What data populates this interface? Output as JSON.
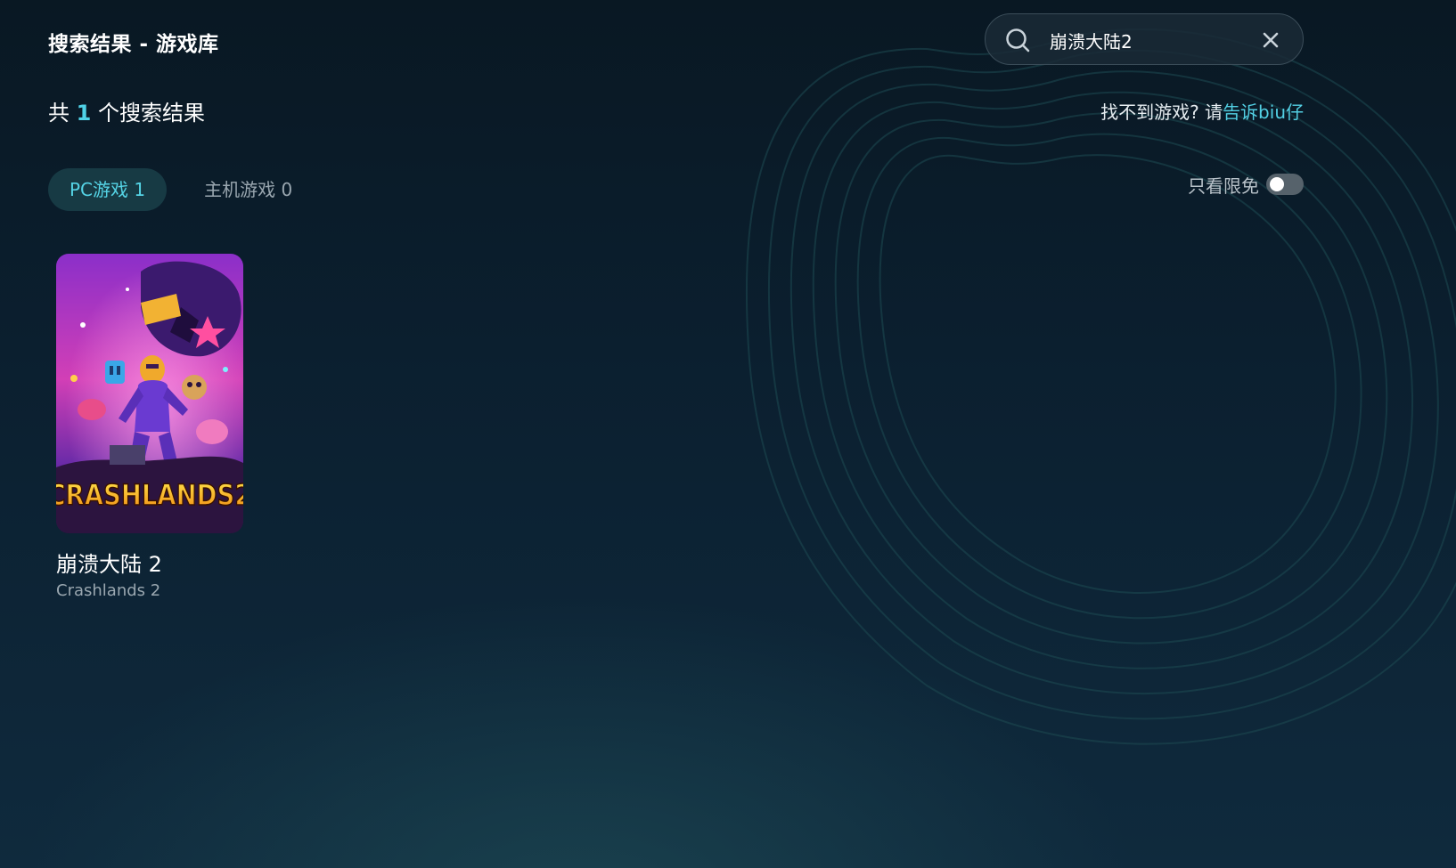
{
  "page": {
    "title": "搜索结果 - 游戏库"
  },
  "search": {
    "value": "崩溃大陆2",
    "placeholder": ""
  },
  "results": {
    "prefix": "共",
    "count": "1",
    "suffix": "个搜索结果"
  },
  "feedback": {
    "text": "找不到游戏? 请",
    "link": "告诉biu仔"
  },
  "tabs": [
    {
      "label": "PC游戏 1",
      "active": true
    },
    {
      "label": "主机游戏 0",
      "active": false
    }
  ],
  "filter": {
    "label": "只看限免",
    "enabled": false
  },
  "games": [
    {
      "title": "崩溃大陆 2",
      "subtitle": "Crashlands 2",
      "cover_logo": "CRASHLANDS2"
    }
  ],
  "colors": {
    "accent": "#4fd1e6",
    "tab_active_bg": "#173a44",
    "background": "#0b1f2f"
  },
  "icons": {
    "search": "search-icon",
    "clear": "close-icon"
  }
}
